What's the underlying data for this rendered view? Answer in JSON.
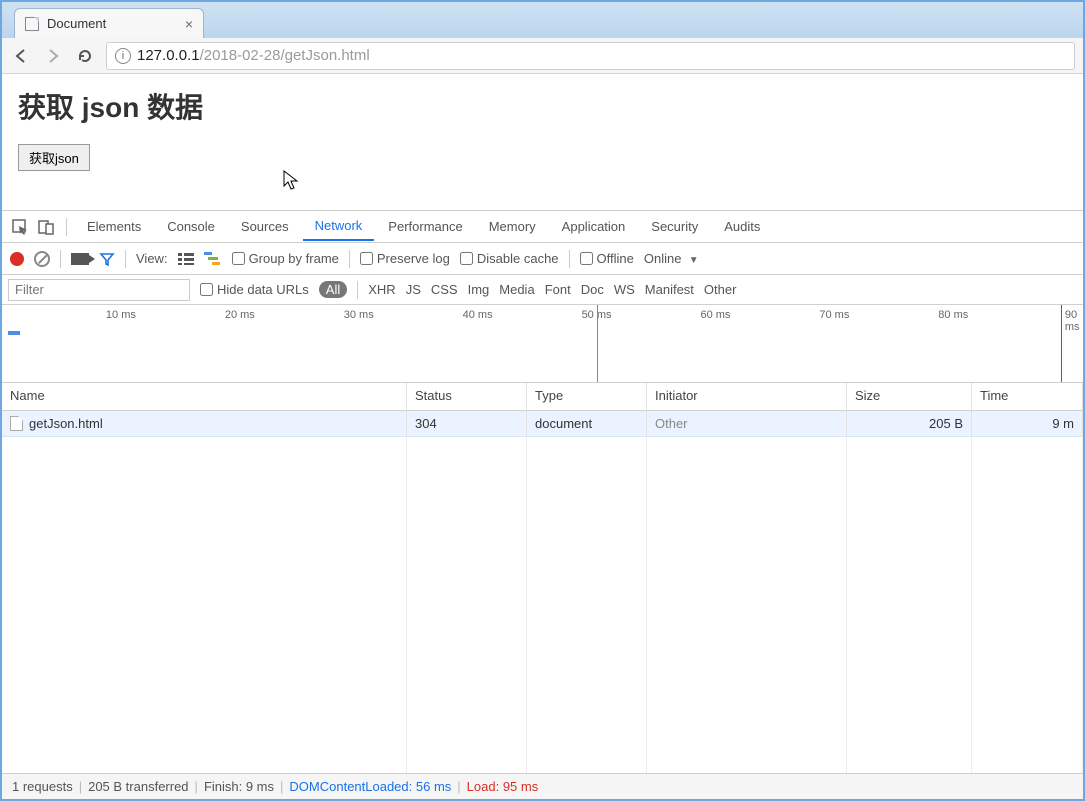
{
  "browser": {
    "tab_title": "Document",
    "url_host": "127.0.0.1",
    "url_path": "/2018-02-28/getJson.html"
  },
  "page": {
    "heading": "获取 json 数据",
    "button_label": "获取json"
  },
  "devtools": {
    "tabs": [
      "Elements",
      "Console",
      "Sources",
      "Network",
      "Performance",
      "Memory",
      "Application",
      "Security",
      "Audits"
    ],
    "active_tab": "Network",
    "toolbar": {
      "view_label": "View:",
      "group_by_frame": "Group by frame",
      "preserve_log": "Preserve log",
      "disable_cache": "Disable cache",
      "offline": "Offline",
      "online": "Online"
    },
    "filterbar": {
      "filter_placeholder": "Filter",
      "hide_data_urls": "Hide data URLs",
      "types": [
        "All",
        "XHR",
        "JS",
        "CSS",
        "Img",
        "Media",
        "Font",
        "Doc",
        "WS",
        "Manifest",
        "Other"
      ],
      "active_type": "All"
    },
    "timeline_ticks": [
      "10 ms",
      "20 ms",
      "30 ms",
      "40 ms",
      "50 ms",
      "60 ms",
      "70 ms",
      "80 ms",
      "90 ms"
    ],
    "columns": [
      "Name",
      "Status",
      "Type",
      "Initiator",
      "Size",
      "Time"
    ],
    "rows": [
      {
        "name": "getJson.html",
        "status": "304",
        "type": "document",
        "initiator": "Other",
        "size": "205 B",
        "time": "9 m"
      }
    ],
    "statusbar": {
      "requests": "1 requests",
      "transferred": "205 B transferred",
      "finish": "Finish: 9 ms",
      "dcl": "DOMContentLoaded: 56 ms",
      "load": "Load: 95 ms"
    }
  }
}
